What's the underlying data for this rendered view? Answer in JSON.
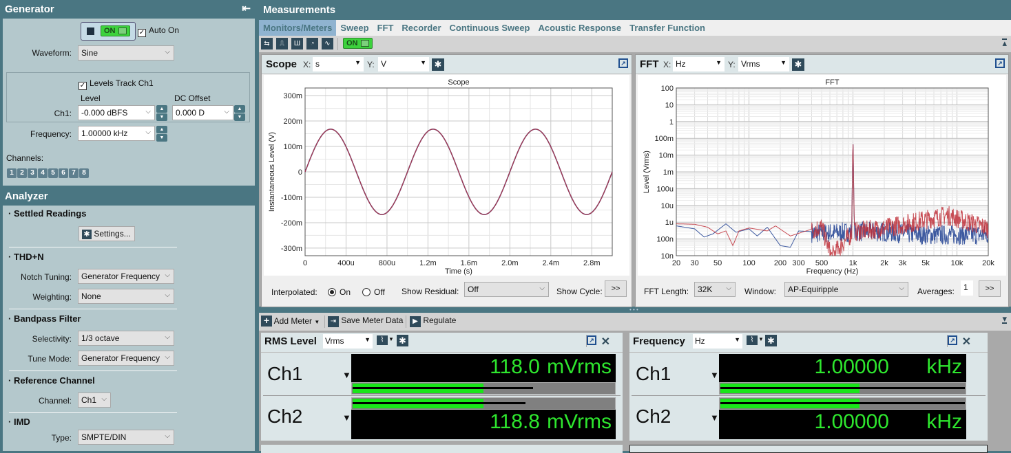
{
  "generator": {
    "title": "Generator",
    "on_label": "ON",
    "auto_on_label": "Auto On",
    "auto_on_checked": true,
    "waveform_label": "Waveform:",
    "waveform_value": "Sine",
    "levels_track_label": "Levels Track Ch1",
    "levels_track_checked": true,
    "level_header": "Level",
    "dc_offset_header": "DC Offset",
    "ch1_label": "Ch1:",
    "level_value": "-0.000 dBFS",
    "dc_offset_value": "0.000 D",
    "frequency_label": "Frequency:",
    "frequency_value": "1.00000 kHz",
    "channels_label": "Channels:",
    "channels": [
      "1",
      "2",
      "3",
      "4",
      "5",
      "6",
      "7",
      "8"
    ]
  },
  "analyzer": {
    "title": "Analyzer",
    "settled_readings": {
      "title": "Settled Readings",
      "settings_button": "Settings..."
    },
    "thdn": {
      "title": "THD+N",
      "notch_label": "Notch Tuning:",
      "notch_value": "Generator Frequency",
      "weighting_label": "Weighting:",
      "weighting_value": "None"
    },
    "bandpass": {
      "title": "Bandpass Filter",
      "selectivity_label": "Selectivity:",
      "selectivity_value": "1/3 octave",
      "tune_label": "Tune Mode:",
      "tune_value": "Generator Frequency"
    },
    "reference": {
      "title": "Reference Channel",
      "channel_label": "Channel:",
      "channel_value": "Ch1"
    },
    "imd": {
      "title": "IMD",
      "type_label": "Type:",
      "type_value": "SMPTE/DIN"
    }
  },
  "measurements": {
    "title": "Measurements",
    "tabs": [
      {
        "label": "Monitors/Meters",
        "active": true
      },
      {
        "label": "Sweep"
      },
      {
        "label": "FFT"
      },
      {
        "label": "Recorder"
      },
      {
        "label": "Continuous Sweep"
      },
      {
        "label": "Acoustic Response"
      },
      {
        "label": "Transfer Function"
      }
    ],
    "toolbar_on_label": "ON"
  },
  "scope": {
    "title": "Scope",
    "x_label": "X:",
    "x_unit": "s",
    "y_label": "Y:",
    "y_unit": "V",
    "interpolated_label": "Interpolated:",
    "interp_on": "On",
    "interp_off": "Off",
    "interp_selected": "On",
    "show_residual_label": "Show Residual:",
    "show_residual_value": "Off",
    "show_cycle_label": "Show Cycle:",
    "more_button": ">>"
  },
  "fft": {
    "title": "FFT",
    "x_label": "X:",
    "x_unit": "Hz",
    "y_label": "Y:",
    "y_unit": "Vrms",
    "fft_length_label": "FFT Length:",
    "fft_length_value": "32K",
    "window_label": "Window:",
    "window_value": "AP-Equiripple",
    "averages_label": "Averages:",
    "averages_value": "1",
    "more_button": ">>"
  },
  "meter_toolbar": {
    "add_meter": "Add Meter",
    "save_meter_data": "Save Meter Data",
    "regulate": "Regulate"
  },
  "meters": [
    {
      "title": "RMS Level",
      "unit_select": "Vrms",
      "channels": [
        {
          "name": "Ch1",
          "value": "118.0",
          "unit": "mVrms",
          "bar_fraction": 0.5,
          "peak_fraction": 0.69
        },
        {
          "name": "Ch2",
          "value": "118.8",
          "unit": "mVrms",
          "bar_fraction": 0.5,
          "peak_fraction": 0.66
        }
      ]
    },
    {
      "title": "Frequency",
      "unit_select": "Hz",
      "channels": [
        {
          "name": "Ch1",
          "value": "1.00000",
          "unit": "kHz",
          "bar_fraction": 0.57,
          "peak_fraction": 1.0
        },
        {
          "name": "Ch2",
          "value": "1.00000",
          "unit": "kHz",
          "bar_fraction": 0.57,
          "peak_fraction": 1.0
        }
      ]
    }
  ],
  "colors": {
    "header": "#4a7682",
    "panel": "#b4c8cc",
    "trace_ch1": "#3e5aa0",
    "trace_ch2": "#c0303a",
    "meter_green": "#2ee62e"
  },
  "chart_data": [
    {
      "type": "line",
      "title": "Scope",
      "xlabel": "Time (s)",
      "ylabel": "Instantaneous Level (V)",
      "xlim": [
        0,
        0.003
      ],
      "ylim": [
        -0.33,
        0.33
      ],
      "x_ticks": [
        "0",
        "400u",
        "800u",
        "1.2m",
        "1.6m",
        "2.0m",
        "2.4m",
        "2.8m"
      ],
      "x_tick_values": [
        0,
        0.0004,
        0.0008,
        0.0012,
        0.0016,
        0.002,
        0.0024,
        0.0028
      ],
      "y_ticks": [
        "300m",
        "200m",
        "100m",
        "0",
        "-100m",
        "-200m",
        "-300m"
      ],
      "y_tick_values": [
        0.3,
        0.2,
        0.1,
        0,
        -0.1,
        -0.2,
        -0.3
      ],
      "grid": true,
      "series": [
        {
          "name": "Ch1",
          "waveform": "sine",
          "amplitude": 0.168,
          "frequency_hz": 1000,
          "phase_deg": 0
        },
        {
          "name": "Ch2",
          "waveform": "sine",
          "amplitude": 0.168,
          "frequency_hz": 1000,
          "phase_deg": 0
        }
      ]
    },
    {
      "type": "line",
      "title": "FFT",
      "xlabel": "Frequency (Hz)",
      "ylabel": "Level (Vrms)",
      "xscale": "log",
      "yscale": "log",
      "xlim": [
        20,
        20000
      ],
      "ylim": [
        1e-08,
        100
      ],
      "x_ticks": [
        "20",
        "30",
        "50",
        "100",
        "200",
        "300",
        "500",
        "1k",
        "2k",
        "3k",
        "5k",
        "10k",
        "20k"
      ],
      "x_tick_values": [
        20,
        30,
        50,
        100,
        200,
        300,
        500,
        1000,
        2000,
        3000,
        5000,
        10000,
        20000
      ],
      "y_ticks": [
        "100",
        "10",
        "1",
        "100m",
        "10m",
        "1m",
        "100u",
        "10u",
        "1u",
        "100n",
        "10n"
      ],
      "y_tick_values": [
        100,
        10,
        1,
        0.1,
        0.01,
        0.001,
        0.0001,
        1e-05,
        1e-06,
        1e-07,
        1e-08
      ],
      "grid": true,
      "series": [
        {
          "name": "Ch1",
          "peak": {
            "x": 1000,
            "y": 0.118
          },
          "noise_floor": [
            [
              20,
              6e-07
            ],
            [
              30,
              4e-07
            ],
            [
              37,
              1.3e-07
            ],
            [
              45,
              2e-07
            ],
            [
              60,
              8e-07
            ],
            [
              75,
              2.5e-07
            ],
            [
              100,
              4e-07
            ],
            [
              120,
              1.5e-07
            ],
            [
              150,
              5e-07
            ],
            [
              200,
              4e-08
            ],
            [
              250,
              3.2e-08
            ],
            [
              300,
              3e-07
            ],
            [
              500,
              2.5e-07
            ],
            [
              1000,
              3e-07
            ],
            [
              2000,
              3e-07
            ],
            [
              5000,
              2e-07
            ],
            [
              10000,
              2e-07
            ],
            [
              20000,
              2e-07
            ]
          ]
        },
        {
          "name": "Ch2",
          "peak": {
            "x": 1000,
            "y": 0.118
          },
          "noise_floor": [
            [
              20,
              8e-07
            ],
            [
              30,
              7.5e-07
            ],
            [
              40,
              5e-07
            ],
            [
              50,
              2e-07
            ],
            [
              60,
              3e-07
            ],
            [
              70,
              4e-08
            ],
            [
              80,
              3e-07
            ],
            [
              100,
              4.5e-07
            ],
            [
              150,
              3e-07
            ],
            [
              180,
              6e-07
            ],
            [
              250,
              1.5e-07
            ],
            [
              500,
              6e-07
            ],
            [
              620,
              1e-08
            ],
            [
              1000,
              3e-07
            ],
            [
              2000,
              5e-07
            ],
            [
              8000,
              3e-06
            ],
            [
              20000,
              5e-07
            ]
          ]
        }
      ]
    }
  ]
}
